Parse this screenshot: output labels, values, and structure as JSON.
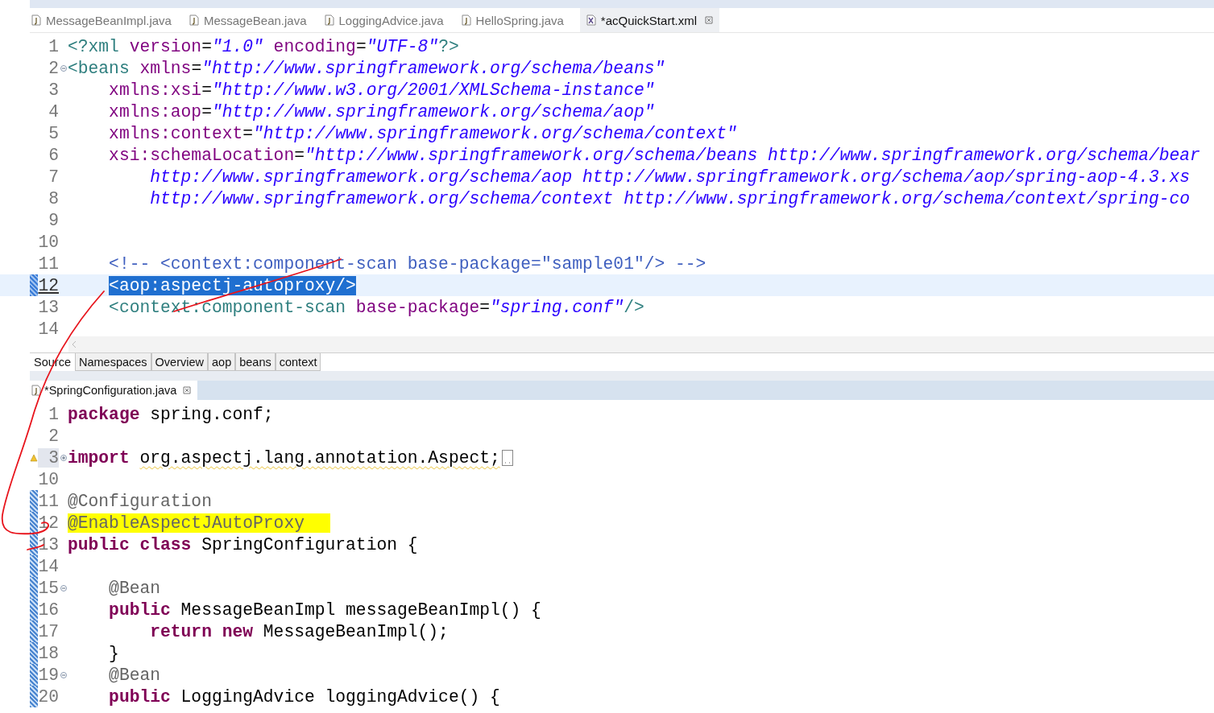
{
  "editor_tabs": [
    {
      "label": "MessageBeanImpl.java",
      "kind": "java",
      "selected": false
    },
    {
      "label": "MessageBean.java",
      "kind": "java",
      "selected": false
    },
    {
      "label": "LoggingAdvice.java",
      "kind": "java",
      "selected": false
    },
    {
      "label": "HelloSpring.java",
      "kind": "java",
      "selected": false
    },
    {
      "label": "*acQuickStart.xml",
      "kind": "xml",
      "selected": true
    }
  ],
  "xml_editor": {
    "lines": [
      {
        "n": "1",
        "current": false,
        "tokens": [
          {
            "kind": "tag",
            "text": "<?xml"
          },
          {
            "kind": "attr",
            "text": " version"
          },
          {
            "kind": "plain",
            "text": "="
          },
          {
            "kind": "str",
            "text": "\"1.0\""
          },
          {
            "kind": "attr",
            "text": " encoding"
          },
          {
            "kind": "plain",
            "text": "="
          },
          {
            "kind": "str",
            "text": "\"UTF-8\""
          },
          {
            "kind": "tag",
            "text": "?>"
          }
        ]
      },
      {
        "n": "2",
        "current": false,
        "expanded": true,
        "tokens": [
          {
            "kind": "tag",
            "text": "<beans"
          },
          {
            "kind": "attr",
            "text": " xmlns"
          },
          {
            "kind": "plain",
            "text": "="
          },
          {
            "kind": "str",
            "text": "\"http://www.springframework.org/schema/beans\""
          }
        ]
      },
      {
        "n": "3",
        "current": false,
        "tokens": [
          {
            "kind": "attr",
            "text": "    xmlns:xsi"
          },
          {
            "kind": "plain",
            "text": "="
          },
          {
            "kind": "str",
            "text": "\"http://www.w3.org/2001/XMLSchema-instance\""
          }
        ]
      },
      {
        "n": "4",
        "current": false,
        "tokens": [
          {
            "kind": "attr",
            "text": "    xmlns:aop"
          },
          {
            "kind": "plain",
            "text": "="
          },
          {
            "kind": "str",
            "text": "\"http://www.springframework.org/schema/aop\""
          }
        ]
      },
      {
        "n": "5",
        "current": false,
        "tokens": [
          {
            "kind": "attr",
            "text": "    xmlns:context"
          },
          {
            "kind": "plain",
            "text": "="
          },
          {
            "kind": "str",
            "text": "\"http://www.springframework.org/schema/context\""
          }
        ]
      },
      {
        "n": "6",
        "current": false,
        "tokens": [
          {
            "kind": "attr",
            "text": "    xsi:schemaLocation"
          },
          {
            "kind": "plain",
            "text": "="
          },
          {
            "kind": "str",
            "text": "\"http://www.springframework.org/schema/beans http://www.springframework.org/schema/bear"
          }
        ]
      },
      {
        "n": "7",
        "current": false,
        "tokens": [
          {
            "kind": "str",
            "text": "        http://www.springframework.org/schema/aop http://www.springframework.org/schema/aop/spring-aop-4.3.xs"
          }
        ]
      },
      {
        "n": "8",
        "current": false,
        "tokens": [
          {
            "kind": "str",
            "text": "        http://www.springframework.org/schema/context http://www.springframework.org/schema/context/spring-co"
          }
        ]
      },
      {
        "n": "9",
        "current": false
      },
      {
        "n": "10",
        "current": false
      },
      {
        "n": "11",
        "current": false,
        "tokens": [
          {
            "kind": "comment",
            "text": "    <!-- <context:component-scan base-package=\"sample01\"/> -->"
          }
        ]
      },
      {
        "n": "12",
        "current": true,
        "indented": true,
        "tokens": [
          {
            "kind": "tag",
            "text": "<aop:aspectj-autoproxy/>",
            "selected": true
          }
        ]
      },
      {
        "n": "13",
        "current": false,
        "tokens": [
          {
            "kind": "tag",
            "text": "    <context:component-scan"
          },
          {
            "kind": "attr",
            "text": " base-package"
          },
          {
            "kind": "plain",
            "text": "="
          },
          {
            "kind": "str",
            "text": "\"spring.conf\""
          },
          {
            "kind": "tag",
            "text": "/>"
          }
        ]
      },
      {
        "n": "14",
        "current": false
      }
    ]
  },
  "page_tabs": [
    {
      "label": "Source",
      "selected": true
    },
    {
      "label": "Namespaces",
      "selected": false
    },
    {
      "label": "Overview",
      "selected": false
    },
    {
      "label": "aop",
      "selected": false
    },
    {
      "label": "beans",
      "selected": false
    },
    {
      "label": "context",
      "selected": false
    }
  ],
  "java_tab": {
    "label": "*SpringConfiguration.java",
    "kind": "java",
    "selected": true
  },
  "java_editor": {
    "lines": [
      {
        "n": "1",
        "changed": false,
        "tokens": [
          {
            "kind": "keyword",
            "text": "package"
          },
          {
            "kind": "plain",
            "text": " spring.conf;"
          }
        ]
      },
      {
        "n": "2",
        "changed": false
      },
      {
        "n": "3",
        "changed": false,
        "warning": true,
        "folded": true,
        "expanded": false,
        "tokens": [
          {
            "kind": "keyword",
            "text": "import "
          },
          {
            "kind": "plain",
            "text": "org.aspectj.lang.annotation.Aspect;",
            "underlined": true
          }
        ]
      },
      {
        "n": "10",
        "changed": false
      },
      {
        "n": "11",
        "changed": true,
        "tokens": [
          {
            "kind": "annotation",
            "text": "@Configuration"
          }
        ]
      },
      {
        "n": "12",
        "changed": true,
        "tokens": [
          {
            "kind": "annotation",
            "text": "@EnableAspectJAutoProxy",
            "marked": true
          }
        ]
      },
      {
        "n": "13",
        "changed": true,
        "tokens": [
          {
            "kind": "keyword",
            "text": "public class"
          },
          {
            "kind": "plain",
            "text": " SpringConfiguration {"
          }
        ]
      },
      {
        "n": "14",
        "changed": true
      },
      {
        "n": "15",
        "changed": true,
        "expanded": true,
        "tokens": [
          {
            "kind": "annotation",
            "text": "    @Bean"
          }
        ]
      },
      {
        "n": "16",
        "changed": true,
        "tokens": [
          {
            "kind": "keyword",
            "text": "    public"
          },
          {
            "kind": "plain",
            "text": " MessageBeanImpl messageBeanImpl() {"
          }
        ]
      },
      {
        "n": "17",
        "changed": true,
        "tokens": [
          {
            "kind": "keyword",
            "text": "        return new"
          },
          {
            "kind": "plain",
            "text": " MessageBeanImpl();"
          }
        ]
      },
      {
        "n": "18",
        "changed": true,
        "tokens": [
          {
            "kind": "plain",
            "text": "    }"
          }
        ]
      },
      {
        "n": "19",
        "changed": true,
        "expanded": true,
        "tokens": [
          {
            "kind": "annotation",
            "text": "    @Bean"
          }
        ]
      },
      {
        "n": "20",
        "changed": true,
        "tokens": [
          {
            "kind": "keyword",
            "text": "    public"
          },
          {
            "kind": "plain",
            "text": " LoggingAdvice loggingAdvice() {"
          }
        ]
      }
    ]
  }
}
